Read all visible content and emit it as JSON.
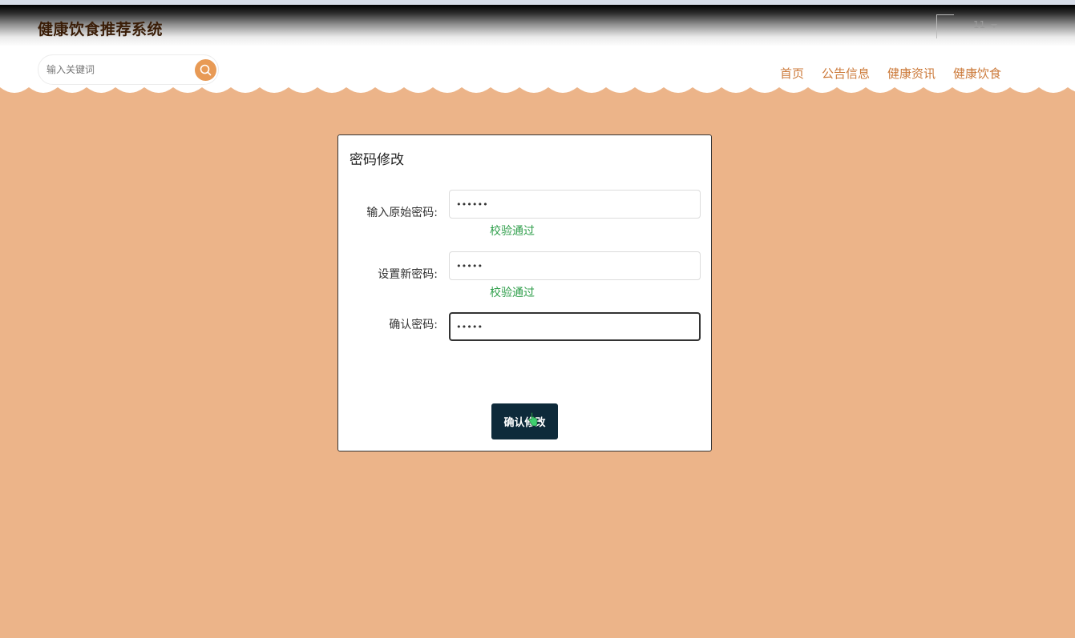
{
  "header": {
    "brand": "健康饮食推荐系统",
    "user_name": "11",
    "search": {
      "placeholder": "输入关键词"
    },
    "nav": [
      {
        "label": "首页"
      },
      {
        "label": "公告信息"
      },
      {
        "label": "健康资讯"
      },
      {
        "label": "健康饮食"
      }
    ]
  },
  "dialog": {
    "title": "密码修改",
    "fields": [
      {
        "label": "输入原始密码:",
        "value": "••••••",
        "status": "校验通过"
      },
      {
        "label": "设置新密码:",
        "value": "•••••",
        "status": "校验通过"
      },
      {
        "label": "确认密码:",
        "value": "•••••"
      }
    ],
    "submit_label": "确认修改"
  },
  "colors": {
    "page_bg": "#ecb489",
    "accent": "#e89a55",
    "nav_text": "#cc7a3a",
    "brand_text": "#3a1d07",
    "valid_text": "#2e9e4a",
    "button_bg": "#0e2a3a"
  }
}
